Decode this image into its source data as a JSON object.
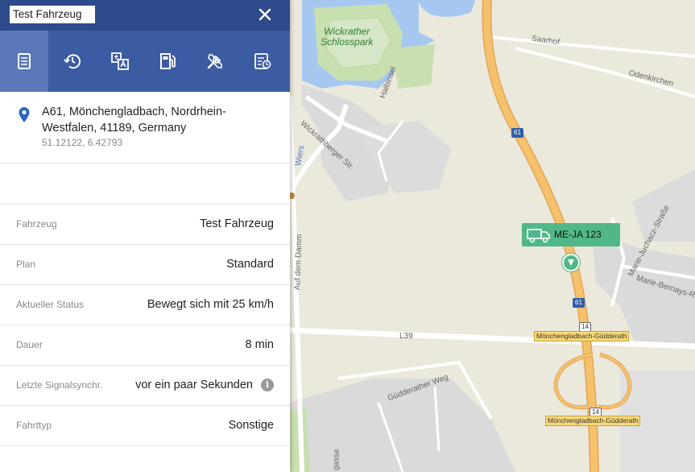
{
  "panel": {
    "title": "Test Fahrzeug",
    "close_glyph": "✕",
    "tabs": [
      {
        "icon": "document-icon",
        "active": true
      },
      {
        "icon": "history-icon",
        "active": false
      },
      {
        "icon": "translate-icon",
        "active": false
      },
      {
        "icon": "fuel-pump-icon",
        "active": false
      },
      {
        "icon": "tools-icon",
        "active": false
      },
      {
        "icon": "schedule-report-icon",
        "active": false
      }
    ],
    "address": {
      "line": "A61, Mönchengladbach, Nordrhein-Westfalen, 41189, Germany",
      "coords": "51.12122, 6.42793"
    },
    "rows": [
      {
        "label": "Fahrzeug",
        "value": "Test Fahrzeug"
      },
      {
        "label": "Plan",
        "value": "Standard"
      },
      {
        "label": "Aktueller Status",
        "value": "Bewegt sich mit 25 km/h"
      },
      {
        "label": "Dauer",
        "value": "8 min"
      },
      {
        "label": "Letzte Signalsynchr.",
        "value": "vor ein paar Sekunden",
        "info_icon": "i"
      },
      {
        "label": "Fahrttyp",
        "value": "Sonstige"
      }
    ]
  },
  "map": {
    "park_label_1": "Wickrather",
    "park_label_2": "Schlosspark",
    "street_saarhof": "Saarhof",
    "street_odenkirchen": "Odenkirchen",
    "street_wickrathberger": "Wickrathberger Str.",
    "street_halbinsel": "Halbinsel",
    "street_guedderather": "Güdderather Weg",
    "street_l39": "L39",
    "street_juchacz": "Marie-Juchacz-Straße",
    "street_bernays": "Marie-Bernays-R",
    "street_auf_dem": "Auf dem Damm",
    "street_gasse": "gasse",
    "street_wiers": "Wiers",
    "shield_61_a": "61",
    "shield_61_b": "61",
    "shield_14_a": "14",
    "shield_14_b": "14",
    "exit_1": "Mönchengladbach-Güdderath",
    "exit_2": "Mönchengladbach-Güdderath",
    "vehicle_plate": "ME-JA 123",
    "vehicle_color": "#52b788",
    "motorway_color": "#f5c16a"
  }
}
